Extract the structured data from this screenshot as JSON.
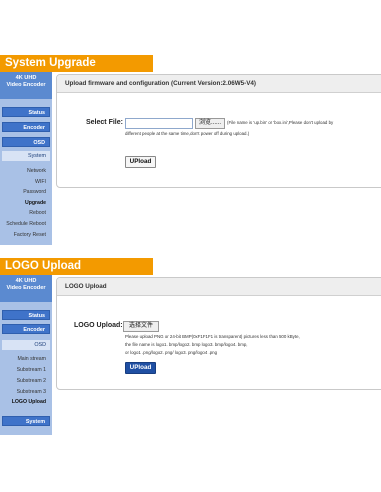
{
  "upgrade": {
    "banner": "System Upgrade",
    "brand": [
      "4K UHD",
      "Video Encoder"
    ],
    "nav": {
      "status": "Status",
      "encoder": "Encoder",
      "osd": "OSD",
      "system": "System"
    },
    "sub_items": [
      "Network",
      "WIFI",
      "Password",
      "Upgrade",
      "Reboot",
      "Schedule Reboot",
      "Factory Reset"
    ],
    "active_item": "Upgrade",
    "panel_title": "Upload firmware and configuration (Current Version:2.06W5-V4)",
    "select_label": "Select File:",
    "file_value": "",
    "browse_label": "浏览......",
    "note_line1": "(File name is 'up.bin' or 'box.ini',Please don't upload by",
    "note_line2": "different people at the same time,don't power off during upload.)",
    "upload_label": "UPload"
  },
  "logo": {
    "banner": "LOGO Upload",
    "brand": [
      "4K UHD",
      "Video Encoder"
    ],
    "nav": {
      "status": "Status",
      "encoder": "Encoder",
      "osd": "OSD",
      "system": "System"
    },
    "sub_items": [
      "Main stream",
      "Substream 1",
      "Substream 2",
      "Substream 3",
      "LOGO Upload"
    ],
    "active_item": "LOGO Upload",
    "panel_title": "LOGO Upload",
    "upload_label_text": "LOGO Upload:",
    "choose_file_label": "选择文件",
    "note_line1": "Please upload PNG or 24-bit BMP(0xF1F1F1 is transparent) pictures less than 500 kByte,",
    "note_line2": "the file name is logo1. bmp/logo2. bmp logo3. bmp/logo4. bmp,",
    "note_line3": "or logo1 .png/logo2. png/ logo3. png/logo4 .png",
    "upload_label": "UPload"
  },
  "colors": {
    "banner": "#f39a00",
    "sidebar": "#a9c1e6",
    "brand": "#5b8ad0",
    "nav_button": "#3f73c9",
    "primary_button": "#1f4fa3"
  }
}
